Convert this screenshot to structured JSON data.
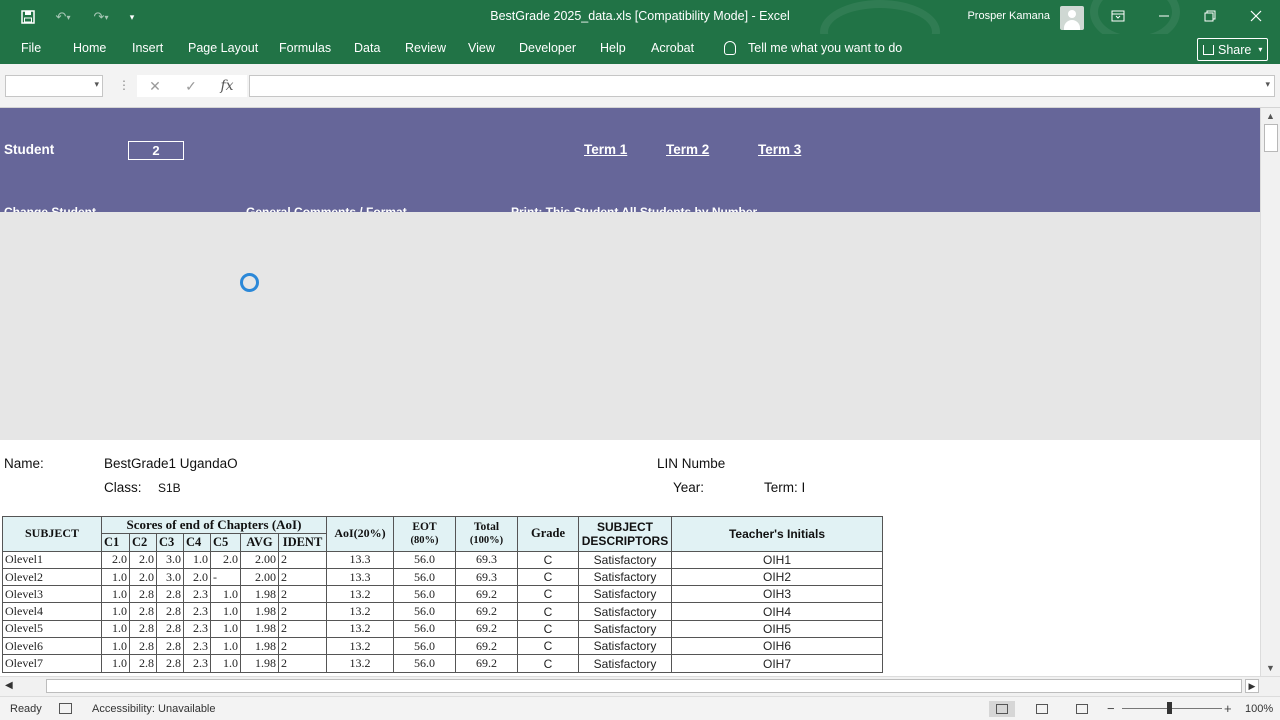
{
  "titlebar": {
    "title": "BestGrade 2025_data.xls  [Compatibility Mode]  -  Excel",
    "user": "Prosper Kamana",
    "qat_icons": [
      "save-icon",
      "undo-icon",
      "redo-icon",
      "customize-qat-icon"
    ],
    "window_icons": [
      "ribbon-display-icon",
      "minimize-icon",
      "restore-icon",
      "close-icon"
    ]
  },
  "ribbon": {
    "tabs": [
      "File",
      "Home",
      "Insert",
      "Page Layout",
      "Formulas",
      "Data",
      "Review",
      "View",
      "Developer",
      "Help",
      "Acrobat"
    ],
    "tell_me": "Tell me what you want to do",
    "share": "Share"
  },
  "formula_bar": {
    "name_box": "",
    "formula": "",
    "fx": "fx",
    "cancel": "✕",
    "enter": "✓"
  },
  "banner": {
    "student_label": "Student",
    "student_number": "2",
    "terms": [
      "Term 1",
      "Term 2",
      "Term 3"
    ],
    "cut_labels": [
      "Change Student",
      "General Comments / Format",
      "Print:   This Student    All    Students by Number"
    ]
  },
  "report": {
    "name_label": "Name:",
    "name_value": "BestGrade1 UgandaO",
    "class_label": "Class:",
    "class_value": "S1B",
    "lin_label": "LIN Numbe",
    "year_label": "Year:",
    "term_label": "Term: I"
  },
  "table": {
    "headers": {
      "subject": "SUBJECT",
      "scores_group": "Scores of end of Chapters (AoI)",
      "sub": [
        "C1",
        "C2",
        "C3",
        "C4",
        "C5",
        "AVG",
        "IDENT"
      ],
      "aoi": "AoI(20%)",
      "eot": "EOT",
      "eot_sub": "(80%)",
      "total": "Total",
      "total_sub": "(100%)",
      "grade": "Grade",
      "descriptors": "SUBJECT DESCRIPTORS",
      "descriptors_l1": "SUBJECT",
      "descriptors_l2": "DESCRIPTORS",
      "teacher": "Teacher's Initials"
    },
    "rows": [
      {
        "subject": "Olevel1",
        "c1": "2.0",
        "c2": "2.0",
        "c3": "3.0",
        "c4": "1.0",
        "c5": "2.0",
        "avg": "2.00",
        "ident": "2",
        "aoi": "13.3",
        "eot": "56.0",
        "total": "69.3",
        "grade": "C",
        "descriptor": "Satisfactory",
        "initials": "OIH1"
      },
      {
        "subject": "Olevel2",
        "c1": "1.0",
        "c2": "2.0",
        "c3": "3.0",
        "c4": "2.0",
        "c5": "-",
        "avg": "2.00",
        "ident": "2",
        "aoi": "13.3",
        "eot": "56.0",
        "total": "69.3",
        "grade": "C",
        "descriptor": "Satisfactory",
        "initials": "OIH2"
      },
      {
        "subject": "Olevel3",
        "c1": "1.0",
        "c2": "2.8",
        "c3": "2.8",
        "c4": "2.3",
        "c5": "1.0",
        "avg": "1.98",
        "ident": "2",
        "aoi": "13.2",
        "eot": "56.0",
        "total": "69.2",
        "grade": "C",
        "descriptor": "Satisfactory",
        "initials": "OIH3"
      },
      {
        "subject": "Olevel4",
        "c1": "1.0",
        "c2": "2.8",
        "c3": "2.8",
        "c4": "2.3",
        "c5": "1.0",
        "avg": "1.98",
        "ident": "2",
        "aoi": "13.2",
        "eot": "56.0",
        "total": "69.2",
        "grade": "C",
        "descriptor": "Satisfactory",
        "initials": "OIH4"
      },
      {
        "subject": "Olevel5",
        "c1": "1.0",
        "c2": "2.8",
        "c3": "2.8",
        "c4": "2.3",
        "c5": "1.0",
        "avg": "1.98",
        "ident": "2",
        "aoi": "13.2",
        "eot": "56.0",
        "total": "69.2",
        "grade": "C",
        "descriptor": "Satisfactory",
        "initials": "OIH5"
      },
      {
        "subject": "Olevel6",
        "c1": "1.0",
        "c2": "2.8",
        "c3": "2.8",
        "c4": "2.3",
        "c5": "1.0",
        "avg": "1.98",
        "ident": "2",
        "aoi": "13.2",
        "eot": "56.0",
        "total": "69.2",
        "grade": "C",
        "descriptor": "Satisfactory",
        "initials": "OIH6"
      },
      {
        "subject": "Olevel7",
        "c1": "1.0",
        "c2": "2.8",
        "c3": "2.8",
        "c4": "2.3",
        "c5": "1.0",
        "avg": "1.98",
        "ident": "2",
        "aoi": "13.2",
        "eot": "56.0",
        "total": "69.2",
        "grade": "C",
        "descriptor": "Satisfactory",
        "initials": "OIH7"
      }
    ]
  },
  "status_bar": {
    "ready": "Ready",
    "accessibility": "Accessibility: Unavailable",
    "zoom": "100%",
    "zoom_out": "−",
    "zoom_in": "+"
  },
  "colors": {
    "excel_green": "#217346",
    "banner_purple": "#666699",
    "header_fill": "#e1f2f4",
    "grey_area": "#e6e6e6",
    "spinner_blue": "#2b88d8"
  }
}
